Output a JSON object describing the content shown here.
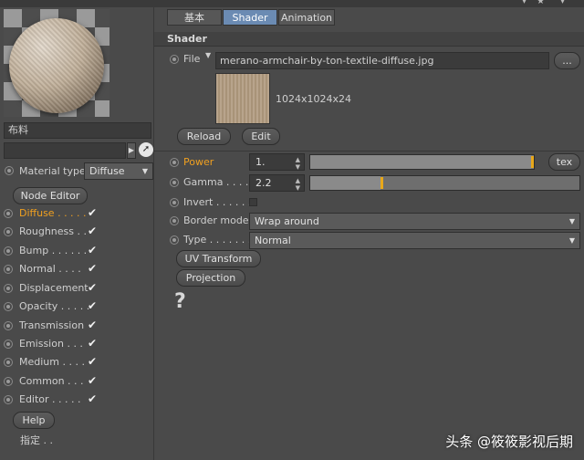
{
  "preview": {
    "material_name": "布料"
  },
  "left": {
    "material_type_label": "Material type",
    "material_type_value": "Diffuse",
    "node_editor_label": "Node Editor",
    "channels": [
      {
        "label": "Diffuse",
        "dots": " . . . . .",
        "checked": true,
        "active": true
      },
      {
        "label": "Roughness",
        "dots": " . .",
        "checked": true,
        "active": false
      },
      {
        "label": "Bump",
        "dots": " . . . . . .",
        "checked": true,
        "active": false
      },
      {
        "label": "Normal",
        "dots": " . . . .",
        "checked": true,
        "active": false
      },
      {
        "label": "Displacement",
        "dots": "",
        "checked": true,
        "active": false
      },
      {
        "label": "Opacity",
        "dots": " . . . . .",
        "checked": true,
        "active": false
      },
      {
        "label": "Transmission",
        "dots": "",
        "checked": true,
        "active": false
      },
      {
        "label": "Emission",
        "dots": " . . .",
        "checked": true,
        "active": false
      },
      {
        "label": "Medium",
        "dots": " . . . .",
        "checked": true,
        "active": false
      },
      {
        "label": "Common",
        "dots": " . . .",
        "checked": true,
        "active": false
      },
      {
        "label": "Editor",
        "dots": " . . . . .",
        "checked": true,
        "active": false
      }
    ],
    "help_label": "Help",
    "assign_label": "指定 . ."
  },
  "tabs": [
    {
      "label": "基本",
      "selected": false
    },
    {
      "label": "Shader",
      "selected": true
    },
    {
      "label": "Animation",
      "selected": false
    }
  ],
  "shader": {
    "section_title": "Shader",
    "file_label": "File",
    "file_value": "merano-armchair-by-ton-textile-diffuse.jpg",
    "browse_label": "...",
    "texture_info": "1024x1024x24",
    "reload_label": "Reload",
    "edit_label": "Edit",
    "power_label": "Power",
    "power_value": "1.",
    "power_slider": 1.0,
    "tex_label": "tex",
    "gamma_label": "Gamma",
    "gamma_dots": " . . . .",
    "gamma_value": "2.2",
    "gamma_slider": 0.27,
    "invert_label": "Invert",
    "invert_dots": " . . . . . .",
    "invert_checked": false,
    "border_mode_label": "Border mode",
    "border_mode_value": "Wrap around",
    "type_label": "Type",
    "type_dots": " . . . . . . . .",
    "type_value": "Normal",
    "uv_transform_label": "UV Transform",
    "projection_label": "Projection",
    "help_icon_glyph": "?"
  },
  "watermark": "头条 @筱筱影视后期",
  "icons": [
    "triangle-down-icon",
    "star-icon",
    "arrow-cursor-icon",
    "play-arrow-icon",
    "help-question-icon"
  ],
  "colors": {
    "accent_orange": "#f0a020",
    "tab_selected": "#6b8bb3",
    "panel_bg": "#4a4a4a"
  }
}
